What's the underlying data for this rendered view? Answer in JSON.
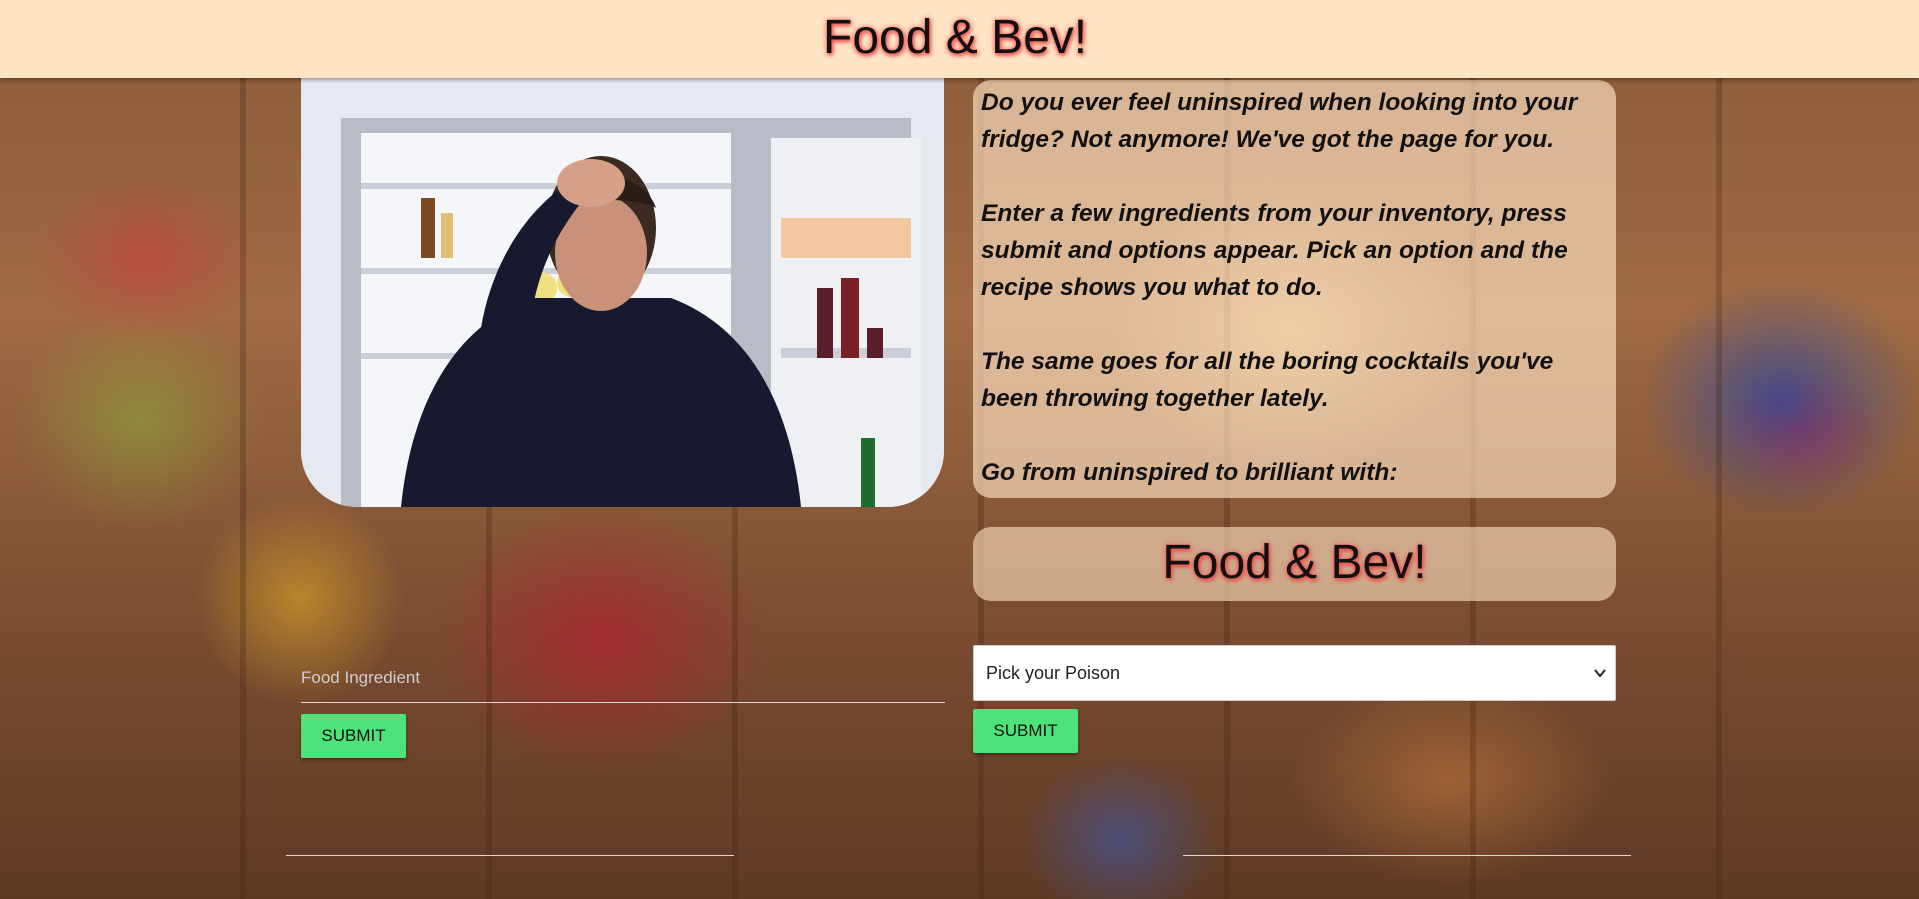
{
  "header": {
    "title": "Food & Bev!"
  },
  "intro": {
    "paragraphs": [
      "Do you ever feel uninspired when looking into your fridge? Not anymore! We've got the page for you.",
      "Enter a few ingredients from your inventory, press submit and options appear. Pick an option and the recipe shows you what to do.",
      "The same goes for all the boring cocktails you've been throwing together lately.",
      "Go from uninspired to brilliant with:"
    ]
  },
  "brand_box": {
    "title": "Food & Bev!"
  },
  "food_form": {
    "placeholder": "Food Ingredient",
    "submit_label": "SUBMIT"
  },
  "bev_form": {
    "selected": "Pick your Poison",
    "submit_label": "SUBMIT"
  },
  "colors": {
    "header_bg": "#ffe4c4",
    "button_bg": "#4ee37a",
    "title_glow": "#ff6060"
  },
  "icons": {
    "select_arrow": "chevron-down-icon"
  }
}
